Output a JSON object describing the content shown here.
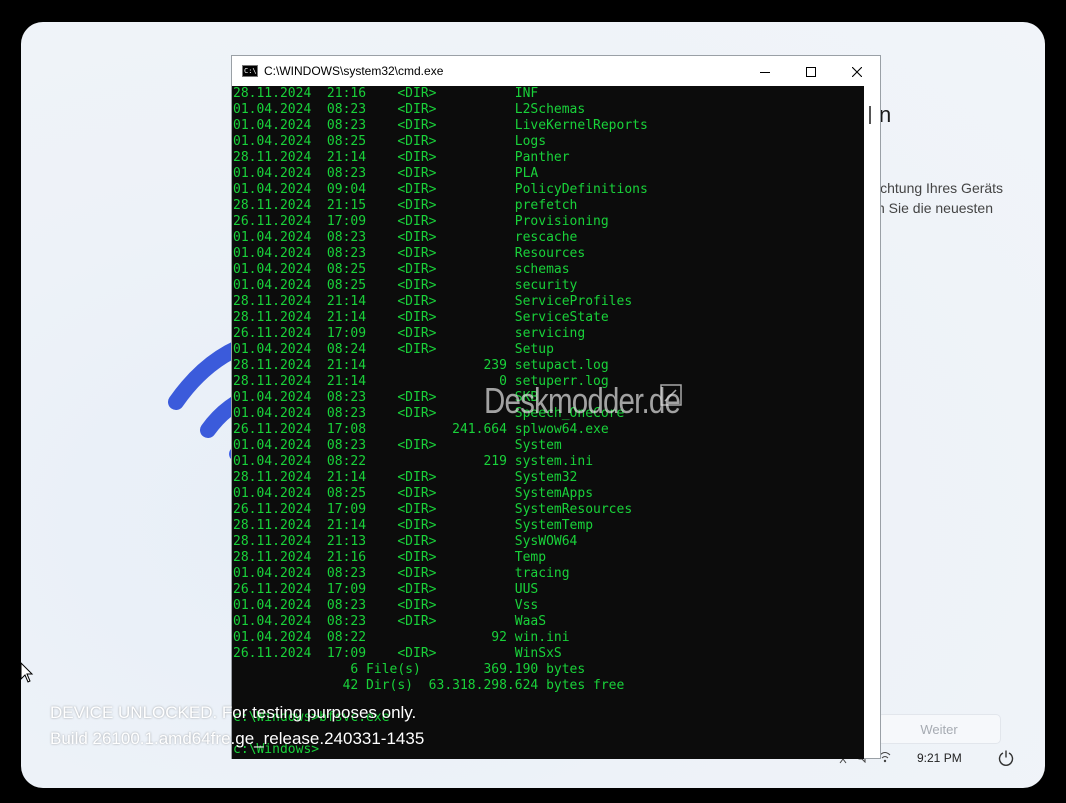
{
  "oobe": {
    "title_fragment": "n",
    "description_line1": "ichtung Ihres Geräts",
    "description_line2": "n Sie die neuesten",
    "next_button": "Weiter",
    "clock": "9:21 PM",
    "tray_icons": [
      "accessibility-icon",
      "volume-icon",
      "network-icon",
      "power-icon"
    ]
  },
  "cmd": {
    "title": "C:\\WINDOWS\\system32\\cmd.exe",
    "lines": [
      "28.11.2024  21:16    <DIR>          INF",
      "01.04.2024  08:23    <DIR>          L2Schemas",
      "01.04.2024  08:23    <DIR>          LiveKernelReports",
      "01.04.2024  08:25    <DIR>          Logs",
      "28.11.2024  21:14    <DIR>          Panther",
      "01.04.2024  08:23    <DIR>          PLA",
      "01.04.2024  09:04    <DIR>          PolicyDefinitions",
      "28.11.2024  21:15    <DIR>          prefetch",
      "26.11.2024  17:09    <DIR>          Provisioning",
      "01.04.2024  08:23    <DIR>          rescache",
      "01.04.2024  08:23    <DIR>          Resources",
      "01.04.2024  08:25    <DIR>          schemas",
      "01.04.2024  08:25    <DIR>          security",
      "28.11.2024  21:14    <DIR>          ServiceProfiles",
      "28.11.2024  21:14    <DIR>          ServiceState",
      "26.11.2024  17:09    <DIR>          servicing",
      "01.04.2024  08:24    <DIR>          Setup",
      "28.11.2024  21:14               239 setupact.log",
      "28.11.2024  21:14                 0 setuperr.log",
      "01.04.2024  08:23    <DIR>          SKB",
      "01.04.2024  08:23    <DIR>          Speech_OneCore",
      "26.11.2024  17:08           241.664 splwow64.exe",
      "01.04.2024  08:23    <DIR>          System",
      "01.04.2024  08:22               219 system.ini",
      "28.11.2024  21:14    <DIR>          System32",
      "01.04.2024  08:25    <DIR>          SystemApps",
      "26.11.2024  17:09    <DIR>          SystemResources",
      "28.11.2024  21:14    <DIR>          SystemTemp",
      "28.11.2024  21:13    <DIR>          SysWOW64",
      "28.11.2024  21:16    <DIR>          Temp",
      "01.04.2024  08:23    <DIR>          tracing",
      "26.11.2024  17:09    <DIR>          UUS",
      "01.04.2024  08:23    <DIR>          Vss",
      "01.04.2024  08:23    <DIR>          WaaS",
      "01.04.2024  08:22                92 win.ini",
      "26.11.2024  17:09    <DIR>          WinSxS",
      "               6 File(s)        369.190 bytes",
      "              42 Dir(s)  63.318.298.624 bytes free",
      "",
      "c:\\Windows>bfsvc.exe",
      "",
      "c:\\Windows>"
    ]
  },
  "watermark": {
    "line1": "DEVICE UNLOCKED. For testing purposes only.",
    "line2": "Build 26100.1.amd64fre.ge_release.240331-1435"
  },
  "deskmodder": "Deskmodder.de"
}
